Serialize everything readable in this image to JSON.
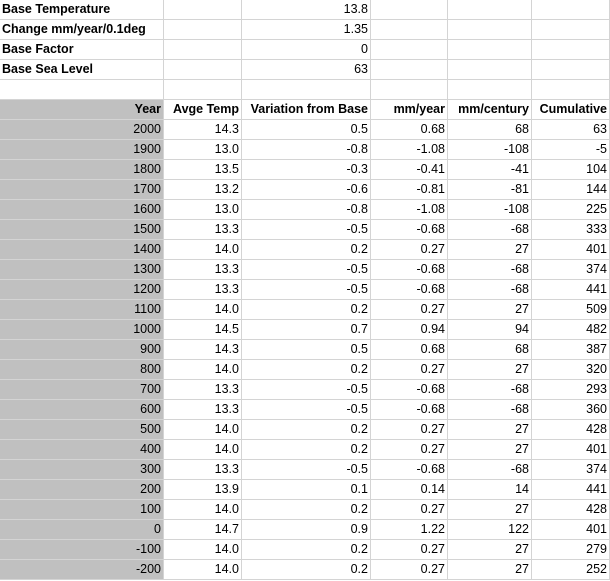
{
  "params": [
    {
      "label": "Base Temperature",
      "value": "13.8"
    },
    {
      "label": "Change mm/year/0.1deg",
      "value": "1.35"
    },
    {
      "label": "Base Factor",
      "value": "0"
    },
    {
      "label": "Base Sea Level",
      "value": "63"
    }
  ],
  "table": {
    "headers": [
      "Year",
      "Avge Temp",
      "Variation from Base",
      "mm/year",
      "mm/century",
      "Cumulative"
    ],
    "rows": [
      [
        "2000",
        "14.3",
        "0.5",
        "0.68",
        "68",
        "63"
      ],
      [
        "1900",
        "13.0",
        "-0.8",
        "-1.08",
        "-108",
        "-5"
      ],
      [
        "1800",
        "13.5",
        "-0.3",
        "-0.41",
        "-41",
        "104"
      ],
      [
        "1700",
        "13.2",
        "-0.6",
        "-0.81",
        "-81",
        "144"
      ],
      [
        "1600",
        "13.0",
        "-0.8",
        "-1.08",
        "-108",
        "225"
      ],
      [
        "1500",
        "13.3",
        "-0.5",
        "-0.68",
        "-68",
        "333"
      ],
      [
        "1400",
        "14.0",
        "0.2",
        "0.27",
        "27",
        "401"
      ],
      [
        "1300",
        "13.3",
        "-0.5",
        "-0.68",
        "-68",
        "374"
      ],
      [
        "1200",
        "13.3",
        "-0.5",
        "-0.68",
        "-68",
        "441"
      ],
      [
        "1100",
        "14.0",
        "0.2",
        "0.27",
        "27",
        "509"
      ],
      [
        "1000",
        "14.5",
        "0.7",
        "0.94",
        "94",
        "482"
      ],
      [
        "900",
        "14.3",
        "0.5",
        "0.68",
        "68",
        "387"
      ],
      [
        "800",
        "14.0",
        "0.2",
        "0.27",
        "27",
        "320"
      ],
      [
        "700",
        "13.3",
        "-0.5",
        "-0.68",
        "-68",
        "293"
      ],
      [
        "600",
        "13.3",
        "-0.5",
        "-0.68",
        "-68",
        "360"
      ],
      [
        "500",
        "14.0",
        "0.2",
        "0.27",
        "27",
        "428"
      ],
      [
        "400",
        "14.0",
        "0.2",
        "0.27",
        "27",
        "401"
      ],
      [
        "300",
        "13.3",
        "-0.5",
        "-0.68",
        "-68",
        "374"
      ],
      [
        "200",
        "13.9",
        "0.1",
        "0.14",
        "14",
        "441"
      ],
      [
        "100",
        "14.0",
        "0.2",
        "0.27",
        "27",
        "428"
      ],
      [
        "0",
        "14.7",
        "0.9",
        "1.22",
        "122",
        "401"
      ],
      [
        "-100",
        "14.0",
        "0.2",
        "0.27",
        "27",
        "279"
      ],
      [
        "-200",
        "14.0",
        "0.2",
        "0.27",
        "27",
        "252"
      ]
    ]
  },
  "colors": {
    "shaded_column": "#c0c0c0",
    "gridline": "#d4d4d4"
  }
}
